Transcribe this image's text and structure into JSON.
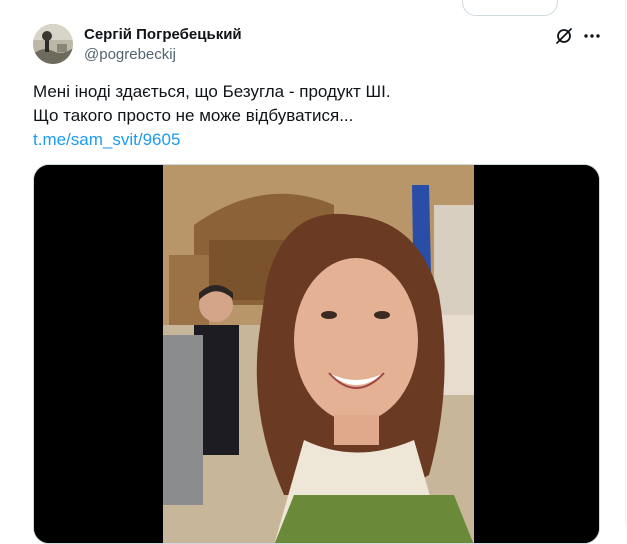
{
  "author": {
    "display_name": "Сергій Погребецький",
    "handle": "@pogrebeckij"
  },
  "tweet": {
    "lines": [
      "Мені іноді здається, що Безугла - продукт ШІ.",
      "Що такого просто не може відбуватися..."
    ],
    "link": "t.me/sam_svit/9605"
  },
  "icons": {
    "grok": "grok-icon",
    "more": "more-icon"
  },
  "colors": {
    "link": "#1d9bf0",
    "text": "#0f1419",
    "secondary": "#536471"
  }
}
